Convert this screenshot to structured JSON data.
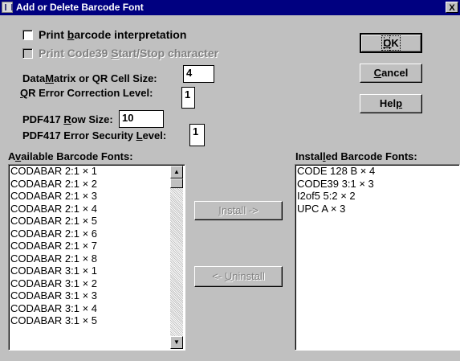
{
  "window": {
    "title": "Add or Delete Barcode Font",
    "close_label": "X"
  },
  "options": {
    "print_interp": {
      "pre": "Print ",
      "key": "b",
      "post": "arcode interpretation",
      "checked": false
    },
    "print_code39": {
      "pre": "Print Code39 ",
      "key": "S",
      "post": "tart/Stop character",
      "checked": false,
      "enabled": false
    }
  },
  "datamatrix": {
    "pre": "Data",
    "key": "M",
    "post": "atrix or QR Cell Size:",
    "value": "4"
  },
  "qr_ecl": {
    "pre": "",
    "key": "Q",
    "post": "R Error Correction Level:",
    "value": "1"
  },
  "pdf_row": {
    "pre": "PDF417 ",
    "key": "R",
    "post": "ow Size:",
    "value": "10"
  },
  "pdf_sec": {
    "pre": "PDF417 Error Security ",
    "key": "L",
    "post": "evel:",
    "value": "1"
  },
  "buttons": {
    "ok": {
      "pre": "",
      "key": "O",
      "post": "K"
    },
    "cancel": {
      "pre": "",
      "key": "C",
      "post": "ancel"
    },
    "help": {
      "pre": "Hel",
      "key": "p",
      "post": ""
    },
    "install": {
      "pre": "",
      "key": "I",
      "post": "nstall ->"
    },
    "uninstall": {
      "pre": "<- ",
      "key": "U",
      "post": "ninstall"
    }
  },
  "available": {
    "label_pre": "A",
    "label_key": "v",
    "label_post": "ailable Barcode Fonts:",
    "items": [
      "CODABAR 2:1 × 1",
      "CODABAR 2:1 × 2",
      "CODABAR 2:1 × 3",
      "CODABAR 2:1 × 4",
      "CODABAR 2:1 × 5",
      "CODABAR 2:1 × 6",
      "CODABAR 2:1 × 7",
      "CODABAR 2:1 × 8",
      "CODABAR 3:1 × 1",
      "CODABAR 3:1 × 2",
      "CODABAR 3:1 × 3",
      "CODABAR 3:1 × 4",
      "CODABAR 3:1 × 5"
    ]
  },
  "installed": {
    "label_pre": "Instal",
    "label_key": "l",
    "label_post": "ed Barcode Fonts:",
    "items": [
      "CODE 128 B × 4",
      "CODE39 3:1 × 3",
      "I2of5 5:2 × 2",
      "UPC A × 3"
    ]
  }
}
